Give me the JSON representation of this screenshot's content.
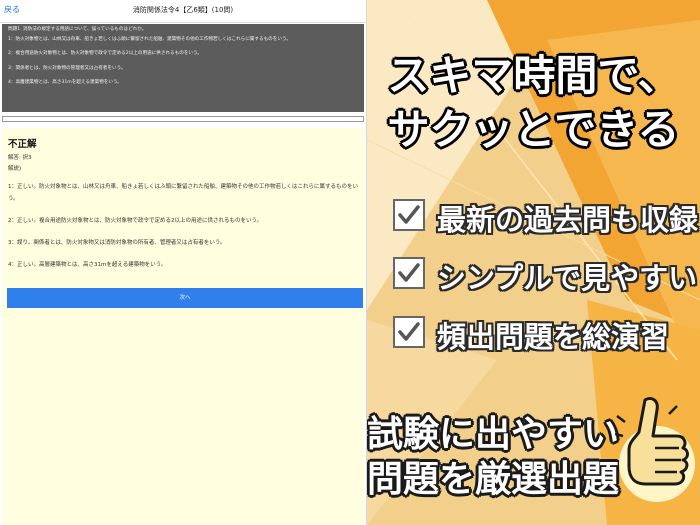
{
  "navbar": {
    "back_label": "戻る",
    "title": "消防関係法令4【乙6類】(10問)"
  },
  "question": {
    "text": "問題1. 消防法の規定する用語について、誤っているものはどれか。",
    "options": [
      "1：防火対象物とは、山林又は舟車、船きょ若しくはふ頭に繋留された船舶、建築物その他の工作物若しくはこれらに属するものをいう。",
      "2：複合用途防火対象物とは、防火対象物で政令で定める2以上の用途に供されるものをいう。",
      "3：関係者とは、防火対象物の管理者又は占有者をいう。",
      "4：高層建築物とは、高さ31mを超える建築物をいう。"
    ]
  },
  "answer": {
    "result": "不正解",
    "answer_line": "解答: 択3",
    "explanation_label": "解説)",
    "explanations": [
      "1：正しい。防火対象物とは、山林又は舟車、船きょ若しくはふ頭に繋留された船舶、建築物その他の工作物若しくはこれらに属するものをいう。",
      "2：正しい。複合用途防火対象物とは、防火対象物で政令で定める2以上の用途に供されるものをいう。",
      "3：誤り。関係者とは、防火対象物又は消防対象物の所有者、管理者又は占有者をいう。",
      "4：正しい。高層建築物とは、高さ31mを超える建築物をいう。"
    ],
    "next_label": "次へ"
  },
  "promo": {
    "headline_line1": "スキマ時間で、",
    "headline_line2": "サクッとできる",
    "features": [
      "最新の過去問も収録",
      "シンプルで見やすい",
      "頻出問題を総演習"
    ],
    "slogan_line1": "試験に出やすい",
    "slogan_line2": "問題を厳選出題",
    "icons": {
      "checkbox": "checkmark-icon",
      "hand": "thumbs-up-hand-icon"
    },
    "colors": {
      "background": "#f2cf8a",
      "accent_orange": "#f3a534",
      "text": "#ffffff",
      "outline": "#1a1a1a"
    }
  }
}
